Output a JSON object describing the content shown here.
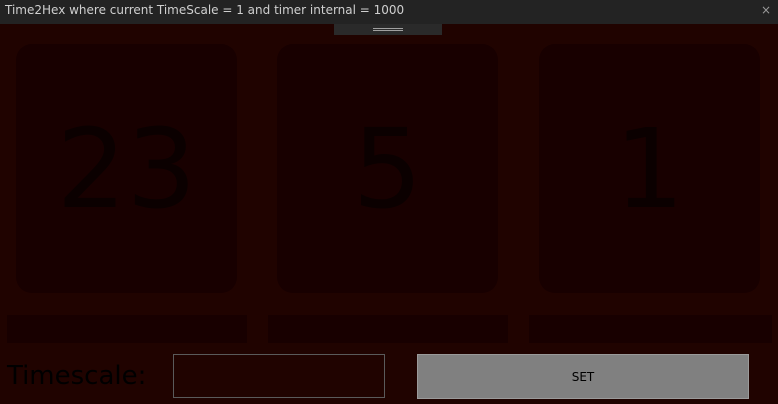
{
  "window": {
    "title": "Time2Hex where current TimeScale = 1 and timer internal = 1000",
    "close_glyph": "×"
  },
  "digits": [
    {
      "value": "23"
    },
    {
      "value": "5"
    },
    {
      "value": "1"
    }
  ],
  "controls": {
    "timescale_label": "Timescale:",
    "timescale_value": "",
    "set_label": "SET"
  },
  "colors": {
    "background": "#200300",
    "card": "#180000",
    "digit_text": "#0b0000",
    "titlebar": "#232323",
    "button": "#808080"
  }
}
